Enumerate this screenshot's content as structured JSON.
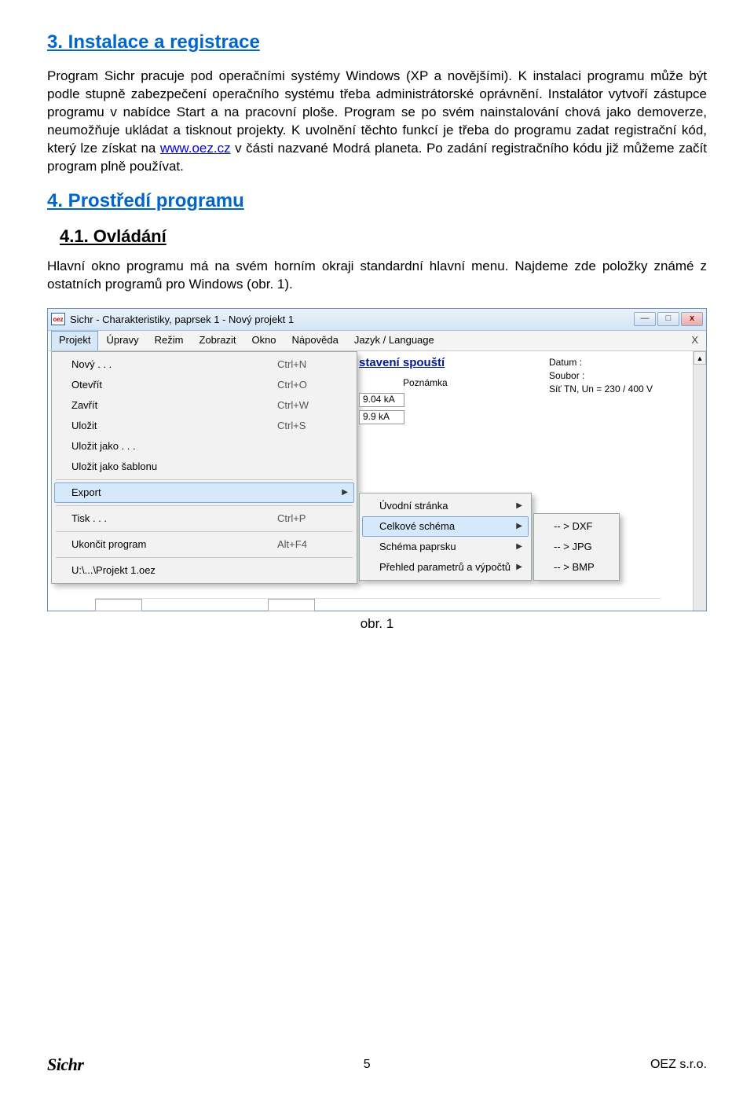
{
  "sections": {
    "s3_title": "3. Instalace a registrace",
    "s3_para": "Program Sichr pracuje pod operačními systémy Windows (XP a novějšími). K instalaci programu může být podle stupně zabezpečení operačního systému třeba administrátorské oprávnění. Instalátor vytvoří zástupce programu v nabídce Start a na pracovní ploše. Program se po svém nainstalování chová jako demoverze, neumožňuje ukládat a tisknout projekty. K uvolnění těchto funkcí je třeba do programu zadat registrační kód, který lze získat na ",
    "s3_link_text": "www.oez.cz",
    "s3_para_tail": " v části nazvané Modrá planeta. Po zadání registračního kódu již můžeme začít program plně používat.",
    "s4_title": "4. Prostředí programu",
    "s41_title": "4.1. Ovládání",
    "s41_para": "Hlavní okno programu má na svém horním okraji standardní hlavní menu. Najdeme zde položky známé z ostatních programů pro Windows (obr. 1)."
  },
  "window": {
    "app_small": "oez",
    "title": "Sichr  - Charakteristiky, paprsek 1 - Nový projekt 1",
    "btn_min": "—",
    "btn_max": "□",
    "btn_close": "x"
  },
  "menubar": {
    "items": [
      "Projekt",
      "Úpravy",
      "Režim",
      "Zobrazit",
      "Okno",
      "Nápověda",
      "Jazyk / Language"
    ],
    "close_x": "X"
  },
  "dropdown": {
    "items": [
      {
        "label": "Nový . . .",
        "shortcut": "Ctrl+N"
      },
      {
        "label": "Otevřít",
        "shortcut": "Ctrl+O"
      },
      {
        "label": "Zavřít",
        "shortcut": "Ctrl+W"
      },
      {
        "label": "Uložit",
        "shortcut": "Ctrl+S"
      },
      {
        "label": "Uložit jako . . .",
        "shortcut": ""
      },
      {
        "label": "Uložit jako šablonu",
        "shortcut": ""
      }
    ],
    "export": {
      "label": "Export",
      "arrow": "▶"
    },
    "items2": [
      {
        "label": "Tisk . . .",
        "shortcut": "Ctrl+P"
      }
    ],
    "items3": [
      {
        "label": "Ukončit program",
        "shortcut": "Alt+F4"
      }
    ],
    "recent": "U:\\...\\Projekt 1.oez"
  },
  "submenu": {
    "items": [
      {
        "label": "Úvodní stránka",
        "arrow": "▶"
      },
      {
        "label": "Celkové schéma",
        "arrow": "▶"
      },
      {
        "label": "Schéma paprsku",
        "arrow": "▶"
      },
      {
        "label": "Přehled parametrů a výpočtů",
        "arrow": "▶"
      }
    ]
  },
  "sub2": {
    "items": [
      {
        "label": "-- >  DXF"
      },
      {
        "label": "-- >  JPG"
      },
      {
        "label": "-- >  BMP"
      }
    ]
  },
  "midstrip": {
    "heading": "stavení spouští",
    "note_label": "Poznámka",
    "v1": "9.04 kA",
    "v2": "9.9 kA"
  },
  "rightpanel": {
    "datum": "Datum :",
    "soubor": "Soubor :",
    "sit": "Síť TN, Un = 230 / 400 V"
  },
  "caption": "obr. 1",
  "footer": {
    "logo": "Sichr",
    "page": "5",
    "company": "OEZ s.r.o."
  }
}
